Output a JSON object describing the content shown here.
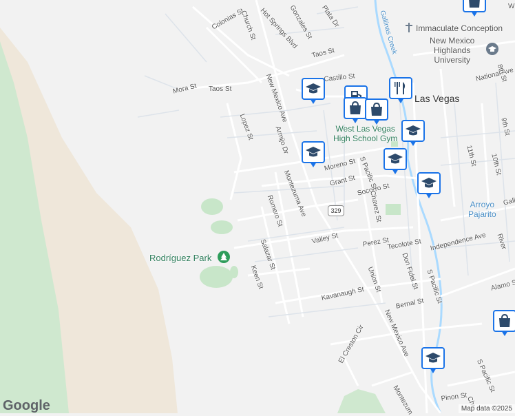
{
  "colors": {
    "park": "#c8e6c9",
    "land": "#f2f2f2",
    "water": "#aadaff",
    "marker_accent": "#1a73e8"
  },
  "streets": [
    "Colonias St",
    "Church St",
    "Hot Springs Blvd",
    "Gonzales St",
    "Plata Dr",
    "Taos St",
    "Taos St",
    "Mora St",
    "Lopez St",
    "New Mexico Ave",
    "Armijo Dr",
    "Montezuma Ave",
    "Moreno St",
    "Grant St",
    "Socorro St",
    "Romero St",
    "Valley St",
    "Salazar St",
    "Keen St",
    "Chavez St",
    "Perez St",
    "Tecolote St",
    "Don Fidel St",
    "S Pacific St",
    "Union St",
    "Kavanaugh St",
    "Bernal St",
    "New Mexico Ave",
    "El Creston Cir",
    "Independence Ave",
    "National Ave",
    "8th St",
    "9th St",
    "11th St",
    "10th St",
    "Alamo St",
    "River",
    "Galli",
    "Pinon St",
    "S Pacific St",
    "Montezum",
    "Chr",
    "Gallinas Creek",
    "S Pacific St",
    "Castillo St",
    "Gonzales St"
  ],
  "places": {
    "park": "Rodríguez Park",
    "university": "New Mexico Highlands University",
    "university_line1": "New Mexico",
    "university_line2": "Highlands",
    "university_line3": "University",
    "church": "Immaculate Conception",
    "gym_line1": "West Las Vegas",
    "gym_line2": "High School Gym",
    "city": "Las Vegas",
    "arroyo_line1": "Arroyo",
    "arroyo_line2": "Pajarito",
    "highway": "329",
    "street_w": "W"
  },
  "icons": [
    "school-icon",
    "shopping-bag-icon",
    "restaurant-icon",
    "park-icon",
    "university-icon",
    "church-icon",
    "gas-icon"
  ],
  "branding": {
    "logo": "Google",
    "attribution": "Map data ©2025"
  }
}
